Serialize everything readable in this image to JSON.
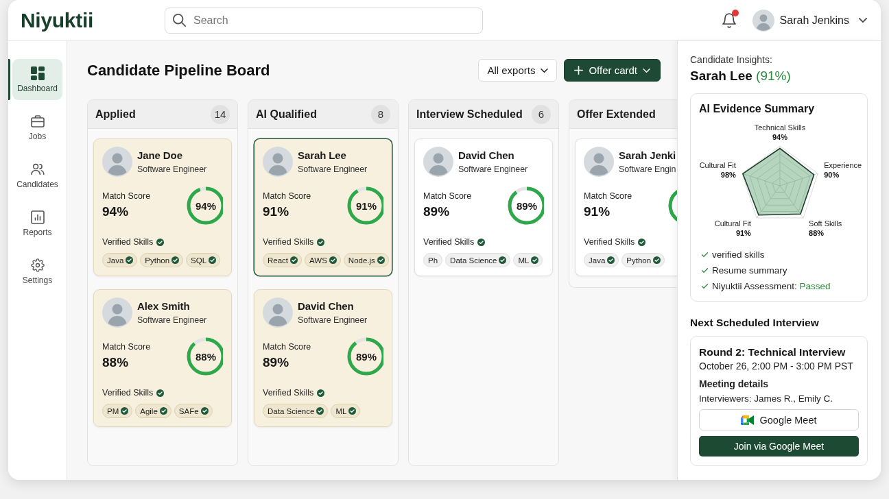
{
  "header": {
    "logo": "Niyuktii",
    "search": {
      "placeholder": "Search"
    },
    "notifications": {
      "unread": true
    },
    "user": {
      "name": "Sarah Jenkins"
    }
  },
  "sidebar": {
    "items": [
      {
        "label": "Dashboard",
        "selected": true
      },
      {
        "label": "Jobs",
        "selected": false
      },
      {
        "label": "Candidates",
        "selected": false
      },
      {
        "label": "Reports",
        "selected": false
      },
      {
        "label": "Settings",
        "selected": false
      }
    ]
  },
  "board": {
    "title": "Candidate Pipeline Board",
    "actions": [
      {
        "kind": "outline",
        "label": "All exports"
      },
      {
        "kind": "primary",
        "label": "Offer cardt"
      }
    ],
    "columns": [
      {
        "title": "Applied",
        "count": "14",
        "cards": [
          {
            "name": "Jane Doe",
            "role": "Software Engineer",
            "score_label": "Match Score",
            "score": "94%",
            "ring_text": "94%",
            "level": 0.94,
            "skills_label": "Verified Skills",
            "skills": [
              {
                "label": "Java",
                "verified": true
              },
              {
                "label": "Python",
                "verified": true
              },
              {
                "label": "SQL",
                "verified": true
              }
            ],
            "highlighted": true,
            "selected": false
          },
          {
            "name": "Alex Smith",
            "role": "Software Engineer",
            "score_label": "Match Score",
            "score": "88%",
            "ring_text": "88%",
            "level": 0.88,
            "skills_label": "Verified Skills",
            "skills": [
              {
                "label": "PM",
                "verified": true
              },
              {
                "label": "Agile",
                "verified": true
              },
              {
                "label": "SAFe",
                "verified": true
              }
            ],
            "highlighted": true,
            "selected": false
          }
        ]
      },
      {
        "title": "AI Qualified",
        "count": "8",
        "cards": [
          {
            "name": "Sarah Lee",
            "role": "Software Engineer",
            "score_label": "Match Score",
            "score": "91%",
            "ring_text": "91%",
            "level": 0.91,
            "skills_label": "Verified Skills",
            "skills": [
              {
                "label": "React",
                "verified": true
              },
              {
                "label": "AWS",
                "verified": true
              },
              {
                "label": "Node.js",
                "verified": true
              }
            ],
            "highlighted": true,
            "selected": true
          },
          {
            "name": "David Chen",
            "role": "Software Engineer",
            "score_label": "Match Score",
            "score": "89%",
            "ring_text": "89%",
            "level": 0.89,
            "skills_label": "Verified Skills",
            "skills": [
              {
                "label": "Data Science",
                "verified": true
              },
              {
                "label": "ML",
                "verified": true
              }
            ],
            "highlighted": true,
            "selected": false
          }
        ]
      },
      {
        "title": "Interview Scheduled",
        "count": "6",
        "cards": [
          {
            "name": "David Chen",
            "role": "Software Engineer",
            "score_label": "Match Score",
            "score": "89%",
            "ring_text": "89%",
            "level": 0.89,
            "skills_label": "Verified Skills",
            "skills": [
              {
                "label": "Ph",
                "verified": false
              },
              {
                "label": "Data Science",
                "verified": true
              },
              {
                "label": "ML",
                "verified": true
              }
            ],
            "highlighted": false,
            "selected": false
          }
        ]
      },
      {
        "title": "Offer Extended",
        "cards": [
          {
            "name": "Sarah Jenki",
            "role": "Software Engin",
            "score_label": "Match Score",
            "score": "91%",
            "skills_label": "Verified Skills",
            "skills": [
              {
                "label": "Java",
                "verified": true
              },
              {
                "label": "Python",
                "verified": true
              }
            ],
            "highlighted": false,
            "selected": false
          }
        ]
      }
    ]
  },
  "insights": {
    "heading": "Candidate Insights:",
    "candidate": "Sarah Lee",
    "score": "(91%)",
    "evidence": {
      "title": "AI Evidence Summary",
      "axes": [
        {
          "label": "Technical Skills",
          "value": "94%"
        },
        {
          "label": "Cultural Fit",
          "value": "98%"
        },
        {
          "label": "Experience",
          "value": "90%"
        },
        {
          "label": "Cultural Fit",
          "value": "91%"
        },
        {
          "label": "Soft Skills",
          "value": "88%"
        }
      ],
      "checks": [
        {
          "text": "verified skills"
        },
        {
          "text": "Resume summary"
        },
        {
          "text": "Niyuktii Assessment:",
          "result": "Passed"
        }
      ]
    },
    "interview": {
      "heading": "Next Scheduled Interview",
      "title": "Round 2: Technical Interview",
      "time": "October 26, 2:00 PM - 3:00 PM PST",
      "details_label": "Meeting details",
      "interviewers": "Interviewers: James R., Emily C.",
      "platform_button": "Google Meet",
      "join_button": "Join via Google Meet"
    }
  }
}
